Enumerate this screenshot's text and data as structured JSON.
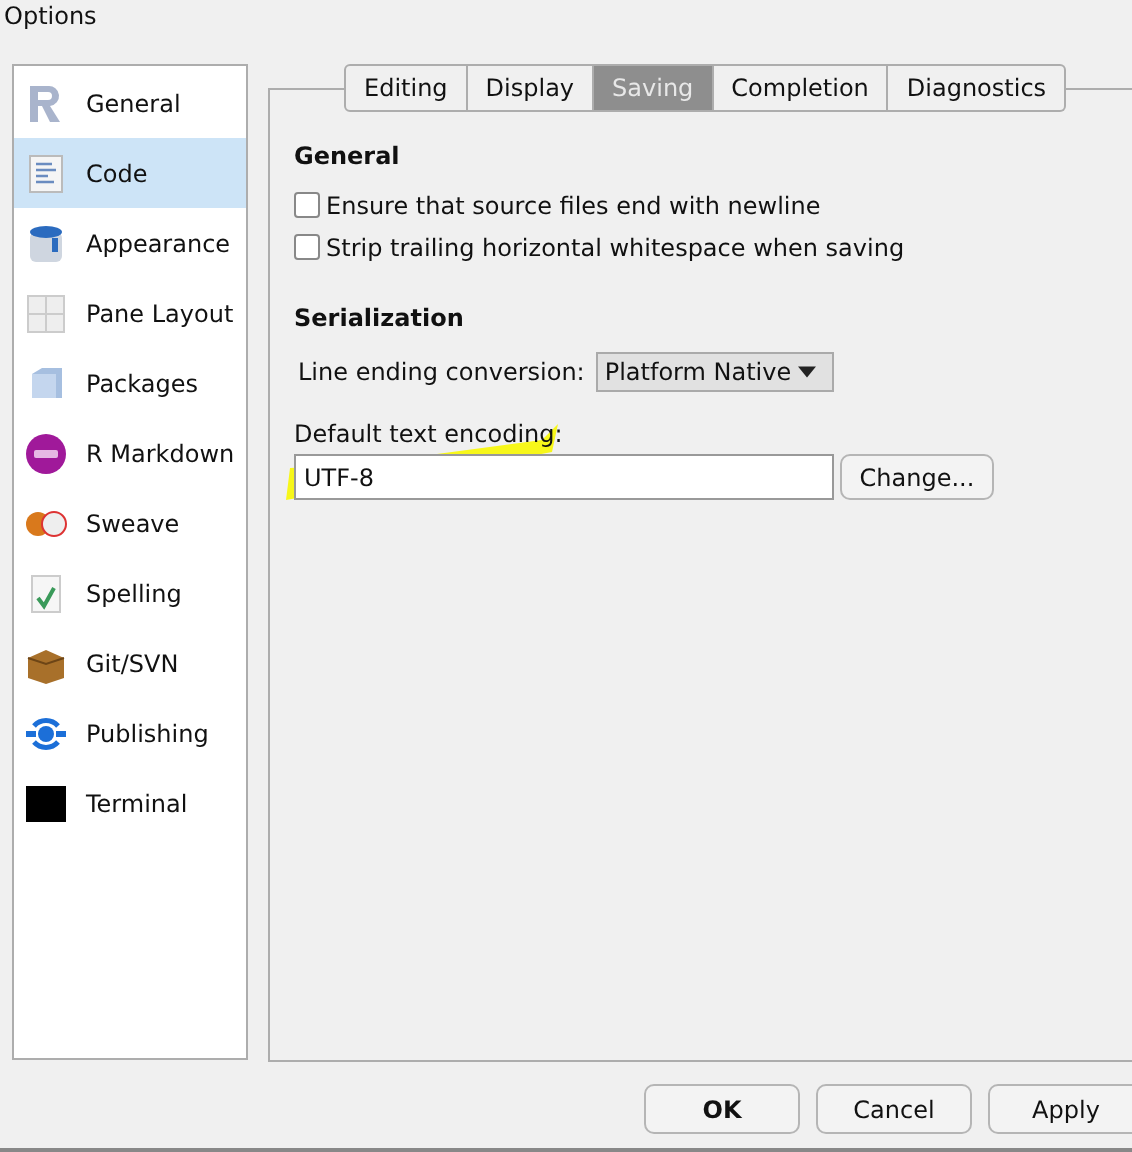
{
  "window": {
    "title": "Options"
  },
  "sidebar": {
    "items": [
      {
        "label": "General",
        "selected": false
      },
      {
        "label": "Code",
        "selected": true
      },
      {
        "label": "Appearance",
        "selected": false
      },
      {
        "label": "Pane Layout",
        "selected": false
      },
      {
        "label": "Packages",
        "selected": false
      },
      {
        "label": "R Markdown",
        "selected": false
      },
      {
        "label": "Sweave",
        "selected": false
      },
      {
        "label": "Spelling",
        "selected": false
      },
      {
        "label": "Git/SVN",
        "selected": false
      },
      {
        "label": "Publishing",
        "selected": false
      },
      {
        "label": "Terminal",
        "selected": false
      }
    ]
  },
  "tabs": [
    {
      "label": "Editing",
      "selected": false
    },
    {
      "label": "Display",
      "selected": false
    },
    {
      "label": "Saving",
      "selected": true
    },
    {
      "label": "Completion",
      "selected": false
    },
    {
      "label": "Diagnostics",
      "selected": false
    }
  ],
  "general": {
    "heading": "General",
    "options": [
      {
        "label": "Ensure that source files end with newline",
        "checked": false
      },
      {
        "label": "Strip trailing horizontal whitespace when saving",
        "checked": false
      }
    ]
  },
  "serialization": {
    "heading": "Serialization",
    "line_ending": {
      "label": "Line ending conversion:",
      "value": "Platform Native"
    },
    "encoding": {
      "label": "Default text encoding:",
      "value": "UTF-8",
      "button": "Change..."
    }
  },
  "buttons": [
    "OK",
    "Cancel",
    "Apply"
  ]
}
